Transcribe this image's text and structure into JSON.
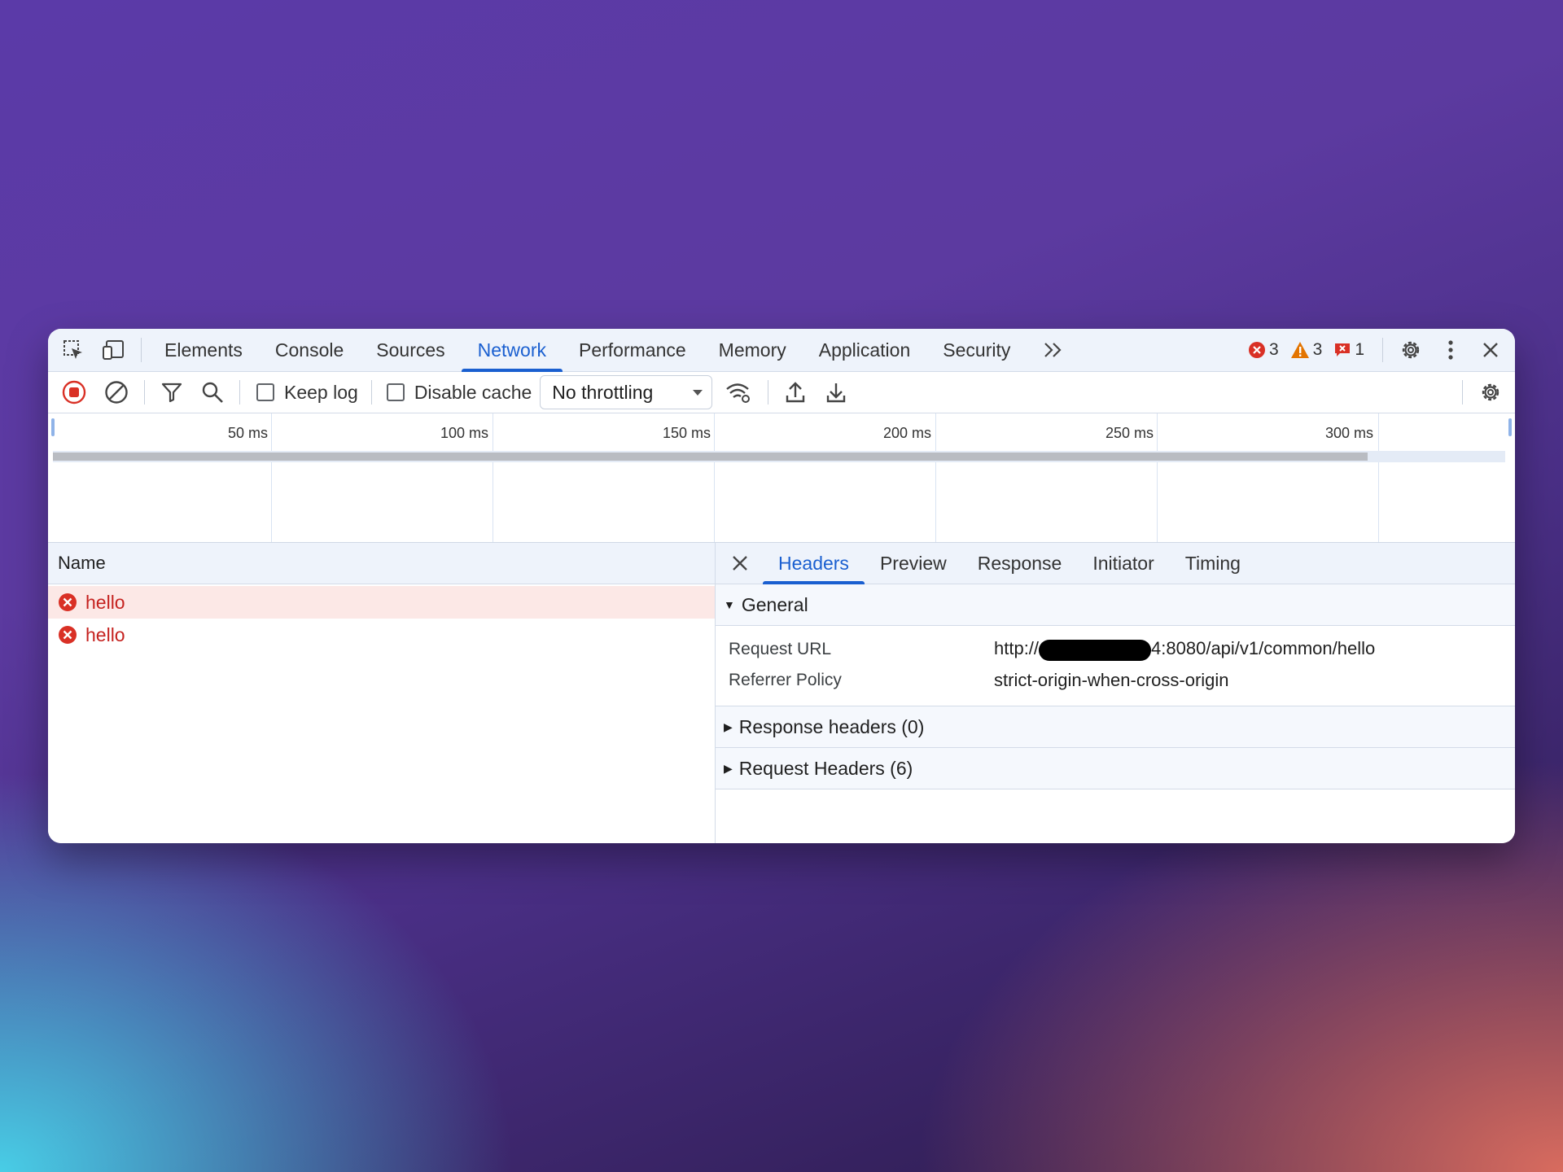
{
  "tabs": [
    {
      "label": "Elements"
    },
    {
      "label": "Console"
    },
    {
      "label": "Sources"
    },
    {
      "label": "Network",
      "active": true
    },
    {
      "label": "Performance"
    },
    {
      "label": "Memory"
    },
    {
      "label": "Application"
    },
    {
      "label": "Security"
    }
  ],
  "more_tabs_icon": ">>",
  "badges": {
    "errors": "3",
    "warnings": "3",
    "issues": "1"
  },
  "toolbar": {
    "keep_log_label": "Keep log",
    "disable_cache_label": "Disable cache",
    "throttling_value": "No throttling"
  },
  "overview": {
    "ticks": [
      "50 ms",
      "100 ms",
      "150 ms",
      "200 ms",
      "250 ms",
      "300 ms"
    ],
    "loaded_fraction": 0.905
  },
  "list": {
    "header": "Name",
    "rows": [
      {
        "name": "hello",
        "status": "error",
        "selected": true
      },
      {
        "name": "hello",
        "status": "error",
        "selected": false
      }
    ]
  },
  "details": {
    "tabs": [
      "Headers",
      "Preview",
      "Response",
      "Initiator",
      "Timing"
    ],
    "active_tab": "Headers",
    "general": {
      "title": "General",
      "request_url_label": "Request URL",
      "request_url_prefix": "http://",
      "request_url_suffix": "4:8080/api/v1/common/hello",
      "referrer_policy_label": "Referrer Policy",
      "referrer_policy_value": "strict-origin-when-cross-origin"
    },
    "response_headers": "Response headers (0)",
    "request_headers": "Request Headers (6)"
  },
  "colors": {
    "accent": "#1a5fd0",
    "error": "#c5221f",
    "selected_row": "#fce8e6"
  }
}
